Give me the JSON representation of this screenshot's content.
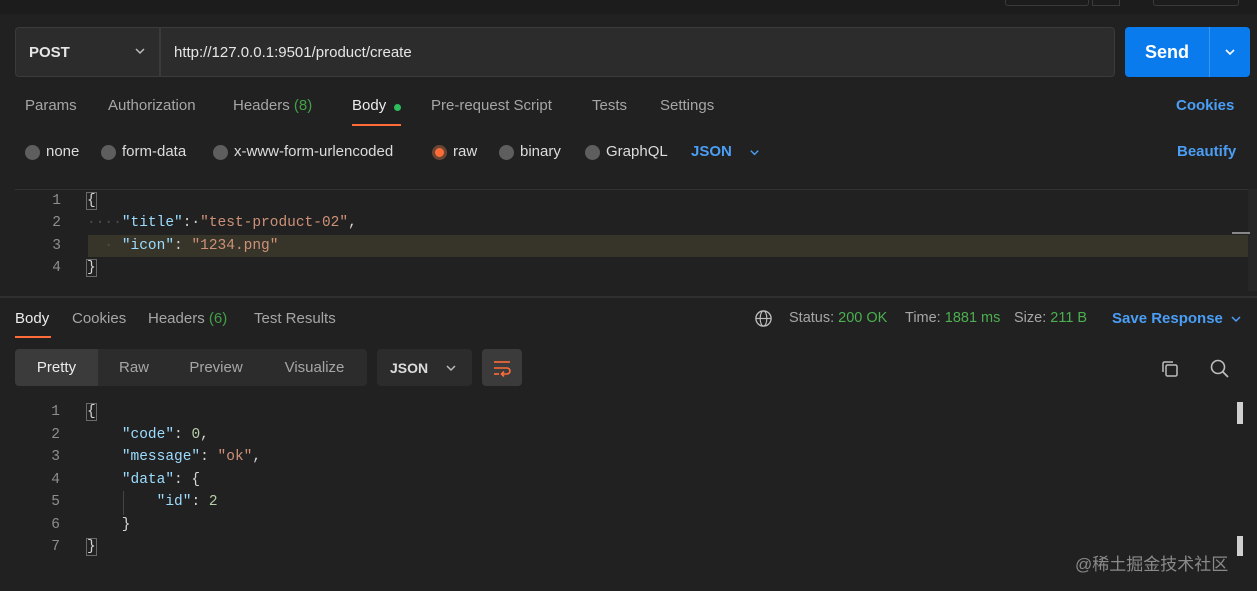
{
  "request": {
    "method": "POST",
    "url": "http://127.0.0.1:9501/product/create",
    "send_label": "Send"
  },
  "request_tabs": [
    {
      "label": "Params"
    },
    {
      "label": "Authorization"
    },
    {
      "label": "Headers",
      "count": "(8)"
    },
    {
      "label": "Body"
    },
    {
      "label": "Pre-request Script"
    },
    {
      "label": "Tests"
    },
    {
      "label": "Settings"
    }
  ],
  "cookies_label": "Cookies",
  "body_types": [
    "none",
    "form-data",
    "x-www-form-urlencoded",
    "raw",
    "binary",
    "GraphQL"
  ],
  "body_type_selected": "raw",
  "raw_format": "JSON",
  "beautify_label": "Beautify",
  "request_body": {
    "line_numbers": [
      "1",
      "2",
      "3",
      "4"
    ],
    "open_brace": "{",
    "close_brace": "}",
    "title_key": "\"title\"",
    "title_value": "\"test-product-02\"",
    "icon_key": "\"icon\"",
    "icon_value": "\"1234.png\""
  },
  "response_tabs": [
    {
      "label": "Body"
    },
    {
      "label": "Cookies"
    },
    {
      "label": "Headers",
      "count": "(6)"
    },
    {
      "label": "Test Results"
    }
  ],
  "response_meta": {
    "status_label": "Status:",
    "status_value": "200 OK",
    "time_label": "Time:",
    "time_value": "1881 ms",
    "size_label": "Size:",
    "size_value": "211 B",
    "save_response": "Save Response"
  },
  "view_modes": [
    "Pretty",
    "Raw",
    "Preview",
    "Visualize"
  ],
  "response_format": "JSON",
  "response_body": {
    "line_numbers": [
      "1",
      "2",
      "3",
      "4",
      "5",
      "6",
      "7"
    ],
    "code_key": "\"code\"",
    "code_value": "0",
    "message_key": "\"message\"",
    "message_value": "\"ok\"",
    "data_key": "\"data\"",
    "id_key": "\"id\"",
    "id_value": "2"
  },
  "watermark": "@稀土掘金技术社区",
  "colors": {
    "accent_orange": "#ff6c37",
    "send_blue": "#097bed",
    "link_blue": "#4a9ef5",
    "status_green": "#4caf50"
  }
}
